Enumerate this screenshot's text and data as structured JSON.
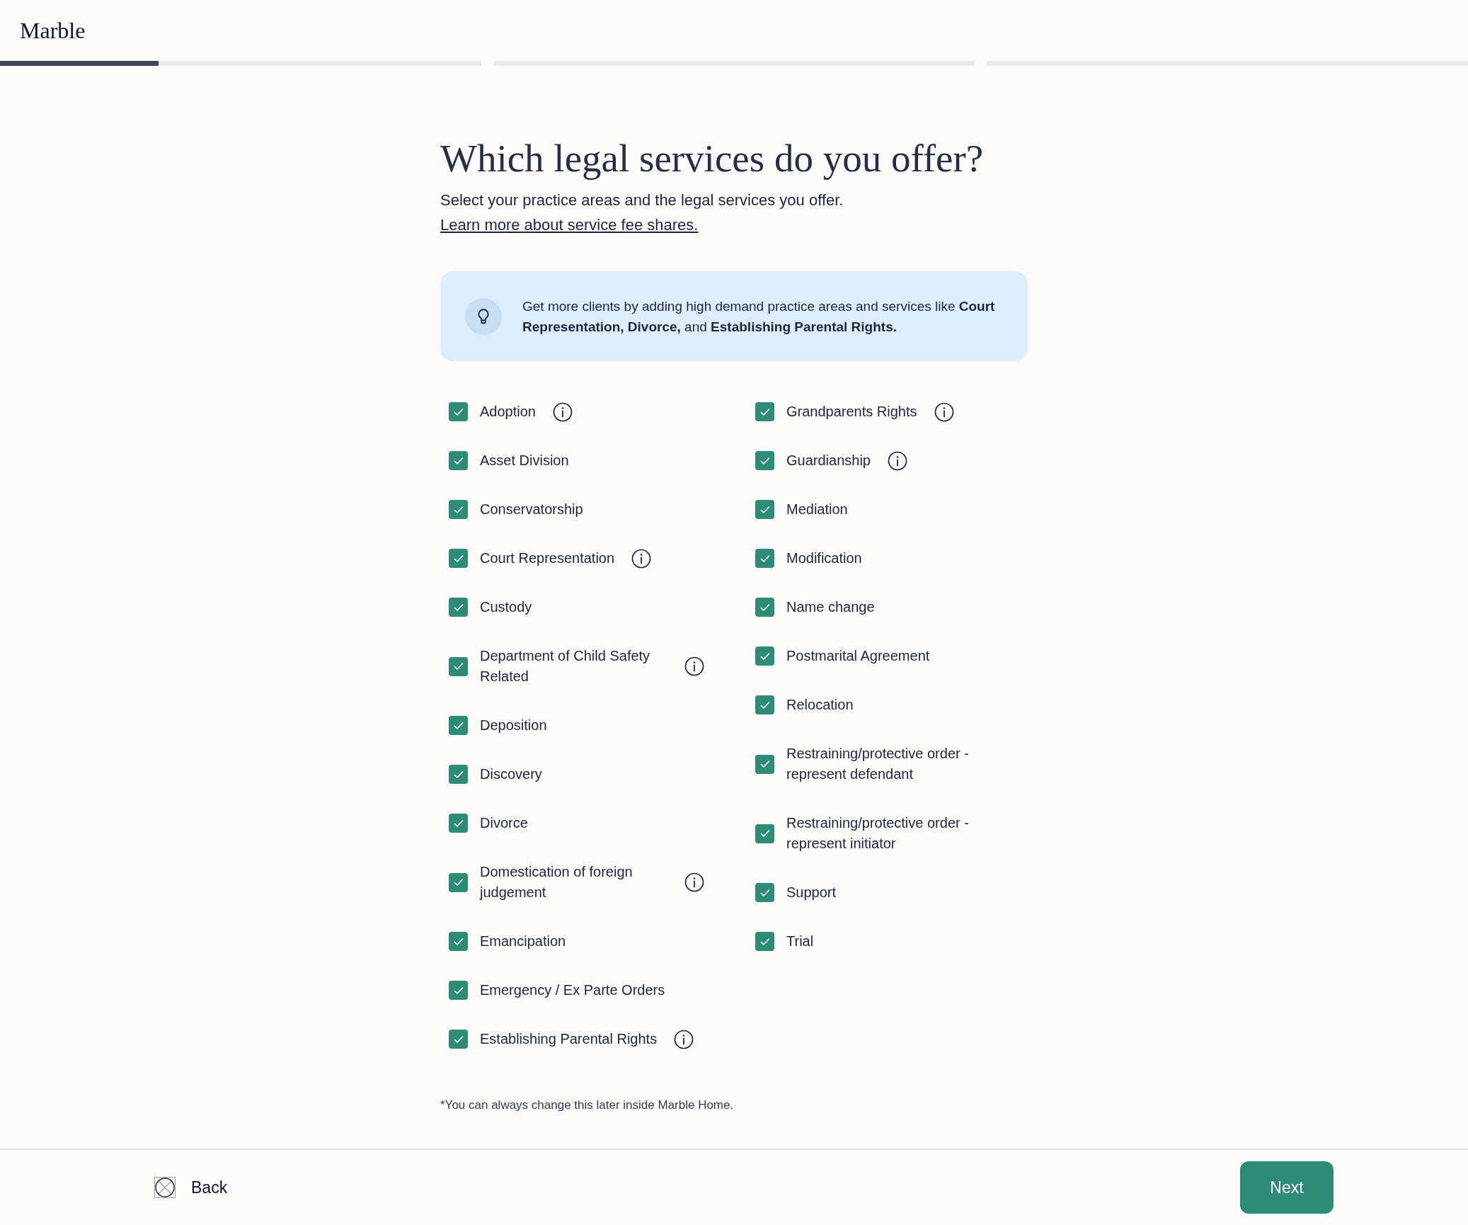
{
  "header": {
    "logo": "Marble"
  },
  "progress": {
    "level": 0.33
  },
  "title": "Which legal services do you offer?",
  "subtitle": {
    "text": "Select your practice areas and the legal services you offer. ",
    "link": "Learn more about service fee shares."
  },
  "tip": {
    "text": "Get more clients by adding high demand practice areas and services like **Court Representation, Divorce,** and **Establishing Parental Rights.**"
  },
  "columns": [
    [
      {
        "label": "Adoption",
        "checked": true,
        "info": true
      },
      {
        "label": "Asset Division",
        "checked": true,
        "info": false
      },
      {
        "label": "Conservatorship",
        "checked": true,
        "info": false
      },
      {
        "label": "Court Representation",
        "checked": true,
        "info": true
      },
      {
        "label": "Custody",
        "checked": true,
        "info": false
      },
      {
        "label": "Department of Child Safety Related",
        "checked": true,
        "info": true
      },
      {
        "label": "Deposition",
        "checked": true,
        "info": false
      },
      {
        "label": "Discovery",
        "checked": true,
        "info": false
      },
      {
        "label": "Divorce",
        "checked": true,
        "info": false
      },
      {
        "label": "Domestication of foreign judgement",
        "checked": true,
        "info": true
      },
      {
        "label": "Emancipation",
        "checked": true,
        "info": false
      },
      {
        "label": "Emergency / Ex Parte Orders",
        "checked": true,
        "info": false
      },
      {
        "label": "Establishing Parental Rights",
        "checked": true,
        "info": true
      }
    ],
    [
      {
        "label": "Grandparents Rights",
        "checked": true,
        "info": true
      },
      {
        "label": "Guardianship",
        "checked": true,
        "info": true
      },
      {
        "label": "Mediation",
        "checked": true,
        "info": false
      },
      {
        "label": "Modification",
        "checked": true,
        "info": false
      },
      {
        "label": "Name change",
        "checked": true,
        "info": false
      },
      {
        "label": "Postmarital Agreement",
        "checked": true,
        "info": false
      },
      {
        "label": "Relocation",
        "checked": true,
        "info": false
      },
      {
        "label": "Restraining/protective order - represent defendant",
        "checked": true,
        "info": false
      },
      {
        "label": "Restraining/protective order - represent initiator",
        "checked": true,
        "info": false
      },
      {
        "label": "Support",
        "checked": true,
        "info": false
      },
      {
        "label": "Trial",
        "checked": true,
        "info": false
      }
    ]
  ],
  "footnote": "*You can always change this later inside Marble Home.",
  "footer": {
    "back": "Back",
    "next": "Next"
  }
}
